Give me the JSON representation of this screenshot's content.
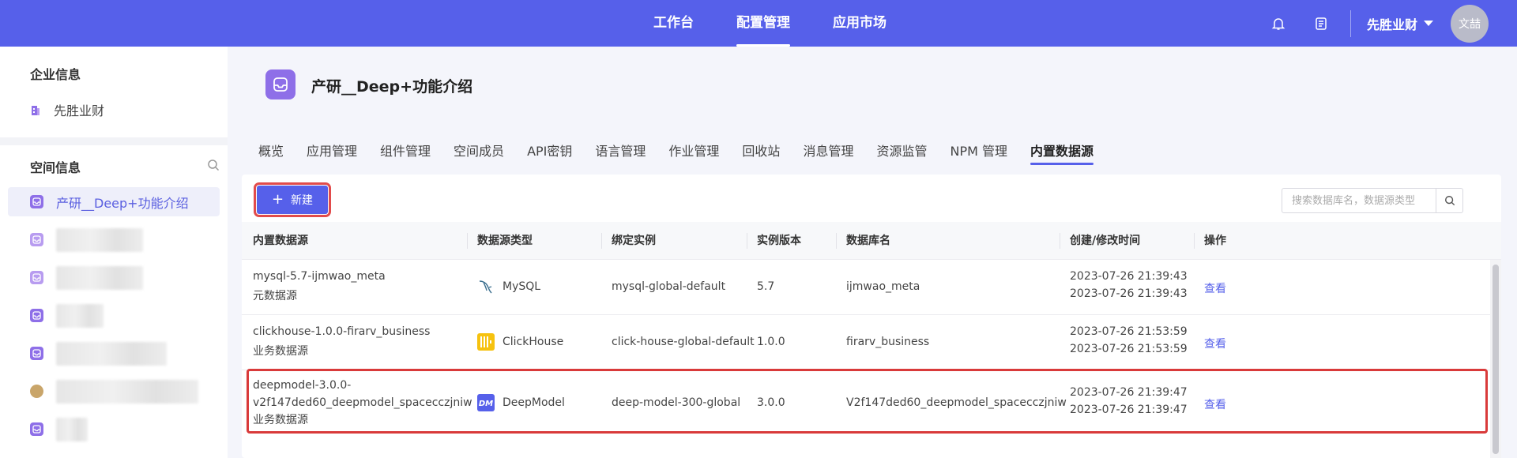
{
  "topnav": {
    "items": [
      {
        "label": "工作台"
      },
      {
        "label": "配置管理",
        "active": true
      },
      {
        "label": "应用市场"
      }
    ],
    "company": "先胜业财",
    "avatar_text": "文喆",
    "icons": [
      "bell-icon",
      "document-icon",
      "chevron-down-icon"
    ]
  },
  "sidebar": {
    "company_section_title": "企业信息",
    "company_item": "先胜业财",
    "space_section_title": "空间信息",
    "active_space": "产研__Deep+功能介绍"
  },
  "header": {
    "title": "产研__Deep+功能介绍"
  },
  "tabs": [
    {
      "label": "概览"
    },
    {
      "label": "应用管理"
    },
    {
      "label": "组件管理"
    },
    {
      "label": "空间成员"
    },
    {
      "label": "API密钥"
    },
    {
      "label": "语言管理"
    },
    {
      "label": "作业管理"
    },
    {
      "label": "回收站"
    },
    {
      "label": "消息管理"
    },
    {
      "label": "资源监管"
    },
    {
      "label": "NPM 管理"
    },
    {
      "label": "内置数据源",
      "active": true
    }
  ],
  "toolbar": {
    "new_label": "新建",
    "search_placeholder": "搜索数据库名，数据源类型"
  },
  "table": {
    "columns": [
      "内置数据源",
      "数据源类型",
      "绑定实例",
      "实例版本",
      "数据库名",
      "创建/修改时间",
      "操作"
    ],
    "rows": [
      {
        "name": "mysql-5.7-ijmwao_meta",
        "category": "元数据源",
        "type": "MySQL",
        "instance": "mysql-global-default",
        "version": "5.7",
        "database": "ijmwao_meta",
        "created": "2023-07-26 21:39:43",
        "modified": "2023-07-26 21:39:43",
        "action": "查看"
      },
      {
        "name": "clickhouse-1.0.0-firarv_business",
        "category": "业务数据源",
        "type": "ClickHouse",
        "instance": "click-house-global-default",
        "version": "1.0.0",
        "database": "firarv_business",
        "created": "2023-07-26 21:53:59",
        "modified": "2023-07-26 21:53:59",
        "action": "查看"
      },
      {
        "name": "deepmodel-3.0.0-",
        "name_line2": "v2f147ded60_deepmodel_spacecczjniw",
        "category": "业务数据源",
        "type": "DeepModel",
        "instance": "deep-model-300-global",
        "version": "3.0.0",
        "database": "V2f147ded60_deepmodel_spacecczjniw",
        "created": "2023-07-26 21:39:47",
        "modified": "2023-07-26 21:39:47",
        "action": "查看"
      }
    ]
  },
  "colors": {
    "brand": "#5660ea",
    "highlight": "#d93a3a",
    "space_icon": "#8e6fe8"
  }
}
